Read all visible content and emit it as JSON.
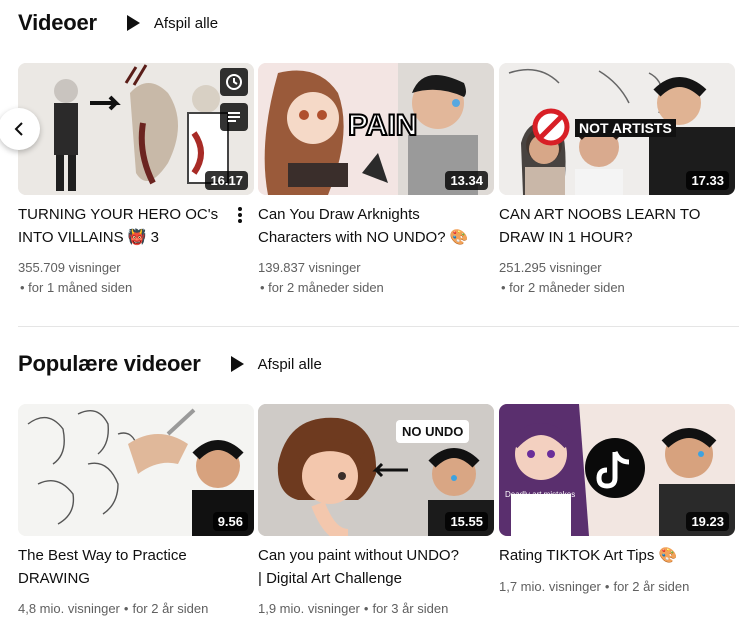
{
  "sections": [
    {
      "title": "Videoer",
      "play_all": "Afspil alle",
      "videos": [
        {
          "title_line1": "TURNING YOUR HERO OC's",
          "title_line2": "INTO VILLAINS 👹 3",
          "duration": "16.17",
          "views": "355.709 visninger",
          "age": "• for 1 måned siden"
        },
        {
          "title_line1": "Can You Draw Arknights",
          "title_line2": "Characters with NO UNDO? 🎨",
          "duration": "13.34",
          "views": "139.837 visninger",
          "age": "• for 2 måneder siden",
          "thumb_text": "PAIN"
        },
        {
          "title_line1": "CAN ART NOOBS LEARN TO",
          "title_line2": "DRAW IN 1 HOUR?",
          "duration": "17.33",
          "views": "251.295 visninger",
          "age": "• for 2 måneder siden",
          "thumb_text": "NOT ARTISTS"
        }
      ]
    },
    {
      "title": "Populære videoer",
      "play_all": "Afspil alle",
      "videos": [
        {
          "title_line1": "The Best Way to Practice",
          "title_line2": "DRAWING",
          "duration": "9.56",
          "meta": "4,8 mio. visninger",
          "age": "for 2 år siden"
        },
        {
          "title_line1": "Can you paint without UNDO?",
          "title_line2": "| Digital Art Challenge",
          "duration": "15.55",
          "meta": "1,9 mio. visninger",
          "age": "for 3 år siden",
          "thumb_text": "NO UNDO"
        },
        {
          "title_line1": "Rating TIKTOK Art Tips 🎨",
          "title_line2": "",
          "duration": "19.23",
          "meta": "1,7 mio. visninger",
          "age": "for 2 år siden",
          "thumb_text": "Deadly art mistakes"
        }
      ]
    }
  ],
  "icons": {
    "prev": "chevron-left-icon",
    "watch_later": "clock-icon",
    "queue": "add-to-queue-icon",
    "more": "more-vert-icon"
  }
}
